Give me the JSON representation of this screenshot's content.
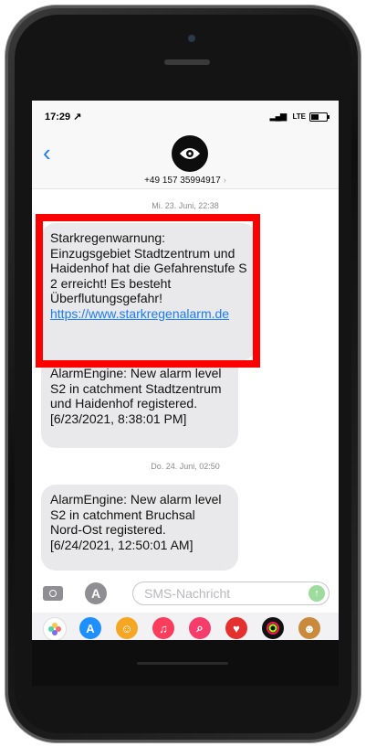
{
  "status_bar": {
    "time": "17:29 ↗",
    "network": "LTE",
    "signal": "▂▄▆"
  },
  "header": {
    "contact": "+49 157 35994917",
    "chevron": "›",
    "back": "‹",
    "avatar_icon": "eye-icon"
  },
  "thread": {
    "date_1": "Mi. 23. Juni, 22:38",
    "msg_1_text": "Starkregenwarnung: Einzugsgebiet Stadtzentrum und Haidenhof hat die Gefahrenstufe S 2 erreicht! Es besteht Überflutungsgefahr! ",
    "msg_1_link": "https://www.starkregenalarm.de",
    "msg_2": "AlarmEngine: New alarm level S2 in catchment Stadtzentrum und Haidenhof registered. [6/23/2021, 8:38:01 PM]",
    "date_2": "Do. 24. Juni, 02:50",
    "msg_3": "AlarmEngine: New alarm level S2 in catchment Bruchsal Nord-Ost registered. [6/24/2021, 12:50:01 AM]"
  },
  "composer": {
    "placeholder": "SMS-Nachricht",
    "send_icon": "arrow-up-icon",
    "apps_label": "A"
  },
  "app_tray": [
    {
      "name": "photos-icon",
      "color": "#ffffff"
    },
    {
      "name": "appstore-icon",
      "color": "#1e8fff"
    },
    {
      "name": "memoji-icon",
      "color": "#f5a623"
    },
    {
      "name": "music-icon",
      "color": "#fb3c5a"
    },
    {
      "name": "search-images-icon",
      "color": "#f53c6a"
    },
    {
      "name": "digital-touch-icon",
      "color": "#e53030"
    },
    {
      "name": "activity-icon",
      "color": "#111111"
    },
    {
      "name": "animoji-icon",
      "color": "#c98a3c"
    }
  ]
}
